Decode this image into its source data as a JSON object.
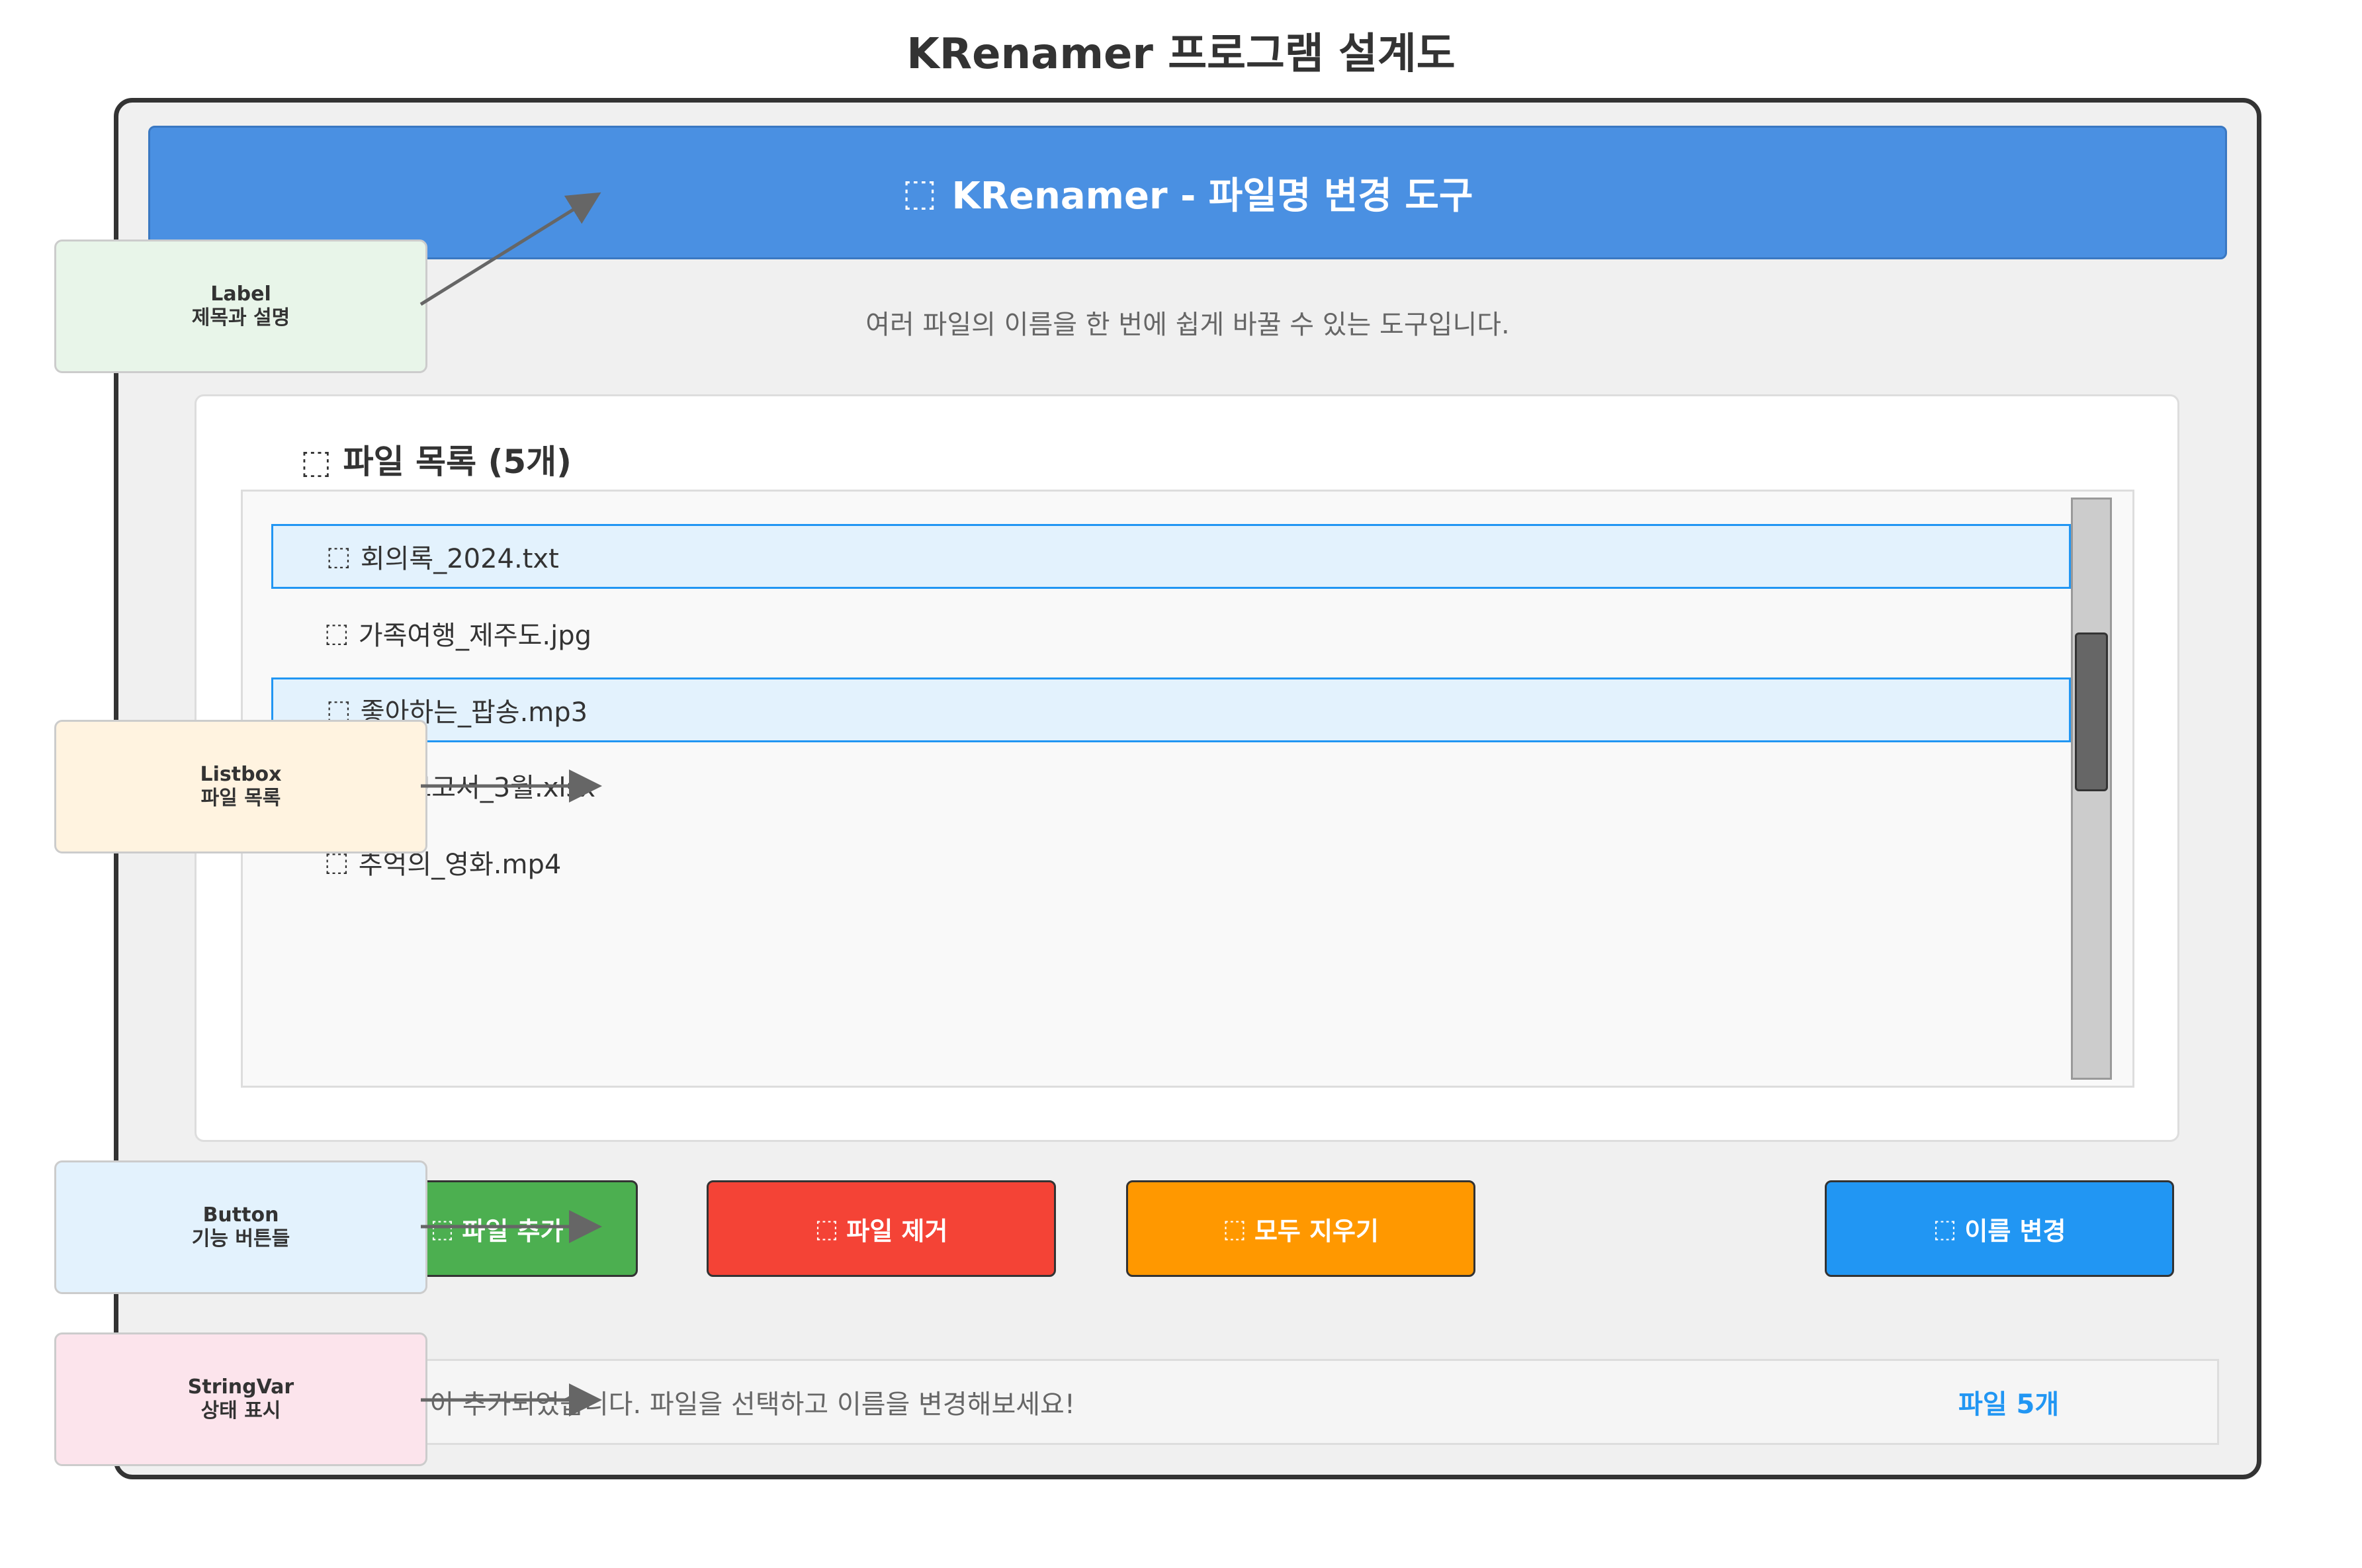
{
  "diagram_title": "KRenamer 프로그램 설계도",
  "app": {
    "header": {
      "icon": "⬚",
      "icon_name": "app-icon",
      "title": "KRenamer - 파일명 변경 도구"
    },
    "subtitle": "여러 파일의 이름을 한 번에 쉽게 바꿀 수 있는 도구입니다.",
    "file_list": {
      "title_icon": "⬚",
      "title": "파일 목록 (5개)",
      "items": [
        {
          "icon": "⬚",
          "icon_name": "file-icon",
          "name": "회의록_2024.txt",
          "selected": true
        },
        {
          "icon": "⬚",
          "icon_name": "file-icon",
          "name": "가족여행_제주도.jpg",
          "selected": false
        },
        {
          "icon": "⬚",
          "icon_name": "file-icon",
          "name": "좋아하는_팝송.mp3",
          "selected": true
        },
        {
          "icon": "⬚",
          "icon_name": "file-icon",
          "name": "월간보고서_3월.xlsx",
          "selected": false
        },
        {
          "icon": "⬚",
          "icon_name": "file-icon",
          "name": "추억의_영화.mp4",
          "selected": false
        }
      ]
    },
    "buttons": {
      "add": {
        "icon": "⬚",
        "label": "파일 추가",
        "color": "#4caf50"
      },
      "remove": {
        "icon": "⬚",
        "label": "파일 제거",
        "color": "#f44336"
      },
      "clear": {
        "icon": "⬚",
        "label": "모두 지우기",
        "color": "#ff9800"
      },
      "rename": {
        "icon": "⬚",
        "label": "이름 변경",
        "color": "#2196f3"
      }
    },
    "status": {
      "message": "5개의 파일이 추가되었습니다. 파일을 선택하고 이름을 변경해보세요!",
      "count": "파일 5개"
    }
  },
  "annotations": {
    "label": {
      "line1": "Label",
      "line2": "제목과 설명",
      "color": "#e8f5e9"
    },
    "listbox": {
      "line1": "Listbox",
      "line2": "파일 목록",
      "color": "#fff3e0"
    },
    "button": {
      "line1": "Button",
      "line2": "기능 버튼들",
      "color": "#e3f2fd"
    },
    "stringvar": {
      "line1": "StringVar",
      "line2": "상태 표시",
      "color": "#fce4ec"
    }
  },
  "colors": {
    "header": "#4a90e2",
    "selection": "#e3f2fd",
    "selection_border": "#2196f3",
    "window_border": "#333333",
    "arrow": "#666666"
  }
}
